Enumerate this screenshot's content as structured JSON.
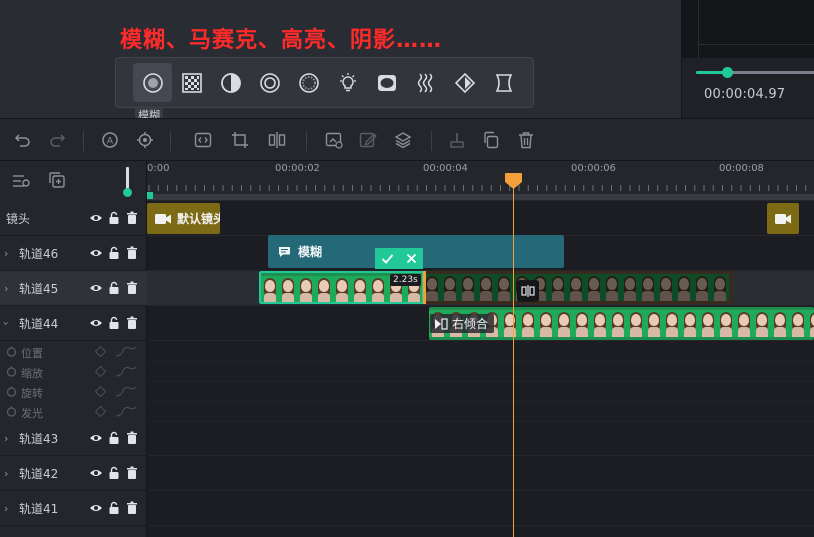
{
  "annotation": {
    "headline": "模糊、马赛克、高亮、阴影……"
  },
  "effects": {
    "items": [
      {
        "id": "blur",
        "icon": "blur-icon",
        "active": true
      },
      {
        "id": "mosaic",
        "icon": "mosaic-icon"
      },
      {
        "id": "contrast",
        "icon": "contrast-icon"
      },
      {
        "id": "ring",
        "icon": "ring-icon"
      },
      {
        "id": "dotted-circle",
        "icon": "dotted-circle-icon"
      },
      {
        "id": "highlight",
        "icon": "lightbulb-icon"
      },
      {
        "id": "vignette",
        "icon": "vignette-icon"
      },
      {
        "id": "wave",
        "icon": "wave-icon"
      },
      {
        "id": "diamond",
        "icon": "diamond-icon"
      },
      {
        "id": "hourglass",
        "icon": "hourglass-icon"
      }
    ],
    "tooltip": "模糊"
  },
  "preview": {
    "timecode": "00:00:04.97",
    "volume": 0.26
  },
  "colors": {
    "accent": "#20c997",
    "playhead": "#f59f3a",
    "headline": "#ff2a2a",
    "camera_clip": "#7d6a14",
    "text_clip": "#256878"
  },
  "toolbar": {
    "icons": [
      "undo-icon",
      "redo-icon",
      "mask-icon",
      "target-icon",
      "code-icon",
      "crop-icon",
      "mirror-icon",
      "replace-icon",
      "edit-icon",
      "layers-icon",
      "trim-icon",
      "copy-icon",
      "delete-icon"
    ]
  },
  "ruler": {
    "labels": [
      "0:00",
      "00:00:02",
      "00:00:04",
      "00:00:06",
      "00:00:08"
    ]
  },
  "tracks": [
    {
      "label": "镜头",
      "type": "camera"
    },
    {
      "label": "轨道46",
      "type": "track"
    },
    {
      "label": "轨道45",
      "type": "track",
      "selected": true
    },
    {
      "label": "轨道44",
      "type": "track",
      "expanded": true
    },
    {
      "label": "轨道43",
      "type": "track"
    },
    {
      "label": "轨道42",
      "type": "track"
    },
    {
      "label": "轨道41",
      "type": "track"
    }
  ],
  "keyframes": [
    "位置",
    "缩放",
    "旋转",
    "发光"
  ],
  "clips": {
    "camera": {
      "label": "默认镜头"
    },
    "text": {
      "label": "模糊"
    },
    "selected_duration": "2.23s",
    "transition": {
      "label": "右倾合"
    }
  }
}
